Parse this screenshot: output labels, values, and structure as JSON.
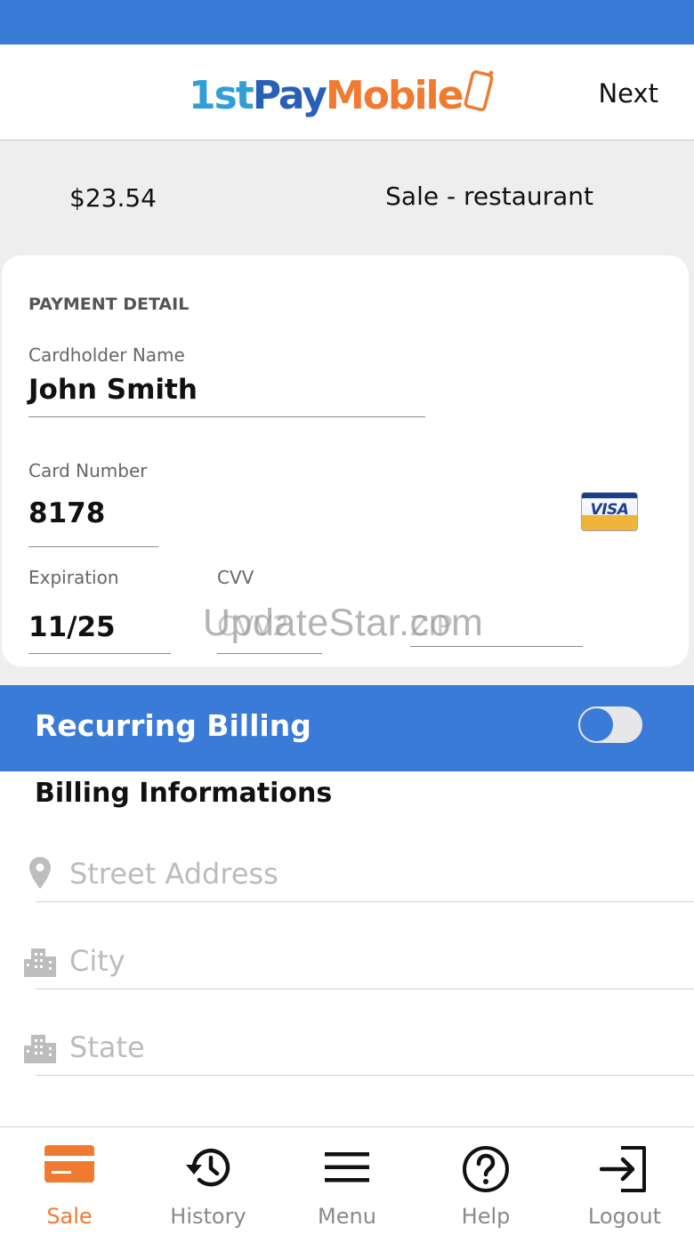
{
  "header": {
    "logo": {
      "part1": "1st",
      "part2": "Pay",
      "part3": "Mobile"
    },
    "next_label": "Next"
  },
  "summary": {
    "amount": "$23.54",
    "sale_type": "Sale - restaurant"
  },
  "payment": {
    "section_title": "PAYMENT DETAIL",
    "cardholder_label": "Cardholder Name",
    "cardholder_value": "John Smith",
    "card_number_label": "Card Number",
    "card_number_value": "8178",
    "card_brand": "VISA",
    "expiration_label": "Expiration",
    "expiration_value": "11/25",
    "cvv_label": "CVV",
    "cvv_placeholder": "CVV2",
    "zip_placeholder": "ZIP"
  },
  "watermark": "UpdateStar.com",
  "recurring": {
    "label": "Recurring Billing",
    "enabled": false
  },
  "billing": {
    "title": "Billing Informations",
    "street_placeholder": "Street Address",
    "city_placeholder": "City",
    "state_placeholder": "State"
  },
  "tabs": [
    {
      "label": "Sale",
      "icon": "card-icon",
      "active": true
    },
    {
      "label": "History",
      "icon": "history-icon",
      "active": false
    },
    {
      "label": "Menu",
      "icon": "menu-icon",
      "active": false
    },
    {
      "label": "Help",
      "icon": "help-icon",
      "active": false
    },
    {
      "label": "Logout",
      "icon": "logout-icon",
      "active": false
    }
  ],
  "colors": {
    "primary_blue": "#3a7bd8",
    "accent_orange": "#f07a30",
    "summary_bg": "#eeeeee"
  }
}
